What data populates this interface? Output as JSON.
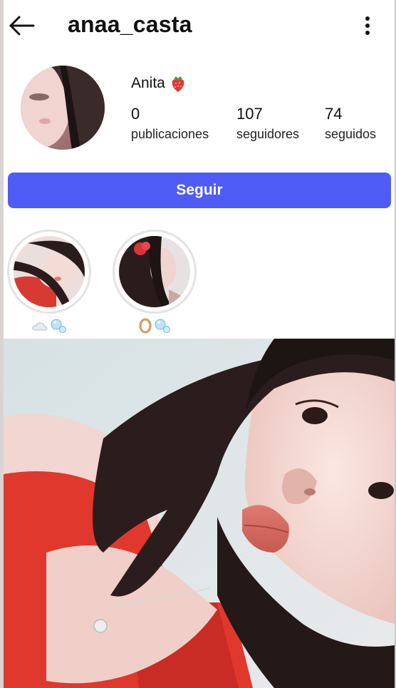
{
  "header": {
    "username": "anaa_casta",
    "back_icon": "arrow-left-icon",
    "more_icon": "more-vertical-icon"
  },
  "profile": {
    "display_name": "Anita",
    "name_emoji": "strawberry-icon",
    "stats": {
      "posts": {
        "value": "0",
        "label": "publicaciones"
      },
      "followers": {
        "value": "107",
        "label": "seguidores"
      },
      "following": {
        "value": "74",
        "label": "seguidos"
      }
    }
  },
  "actions": {
    "follow_label": "Seguir",
    "follow_color": "#4f5bf5"
  },
  "highlights": [
    {
      "icons": [
        "cloud-icon",
        "bubbles-icon"
      ]
    },
    {
      "icons": [
        "ring-icon",
        "bubbles-icon"
      ]
    }
  ],
  "colors": {
    "accent": "#4f5bf5",
    "dress": "#e0382d"
  }
}
